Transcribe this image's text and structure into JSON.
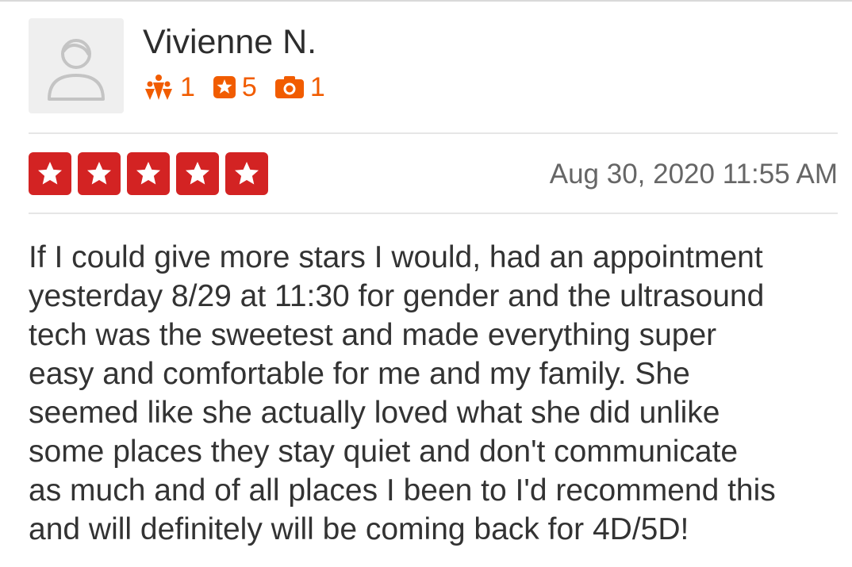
{
  "review": {
    "user": {
      "name": "Vivienne N.",
      "avatar_icon": "default-avatar-icon",
      "stats": {
        "friends": "1",
        "reviews": "5",
        "photos": "1"
      },
      "stat_color": "#f15c00"
    },
    "rating": {
      "stars": 5,
      "max": 5,
      "color": "#d32323"
    },
    "date": "Aug 30, 2020 11:55 AM",
    "text_lines": [
      "If I could give more stars I would, had an appointment",
      "yesterday 8/29 at 11:30 for gender and the ultrasound",
      "tech was the sweetest and made everything super",
      "easy and comfortable for me and my family. She",
      "seemed like she actually loved what she did unlike",
      "some places they stay quiet and don't communicate",
      "as much and of all places I been to I'd recommend this",
      "and will definitely will be coming back for 4D/5D!"
    ]
  }
}
